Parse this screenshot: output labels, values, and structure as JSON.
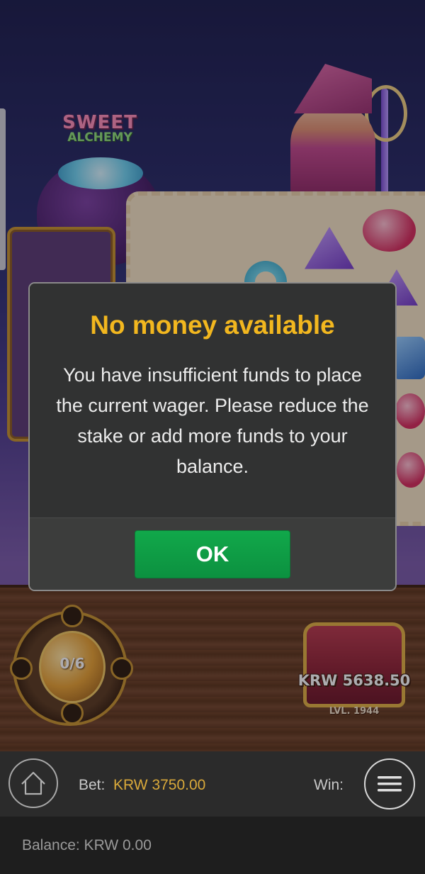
{
  "game": {
    "logo_line1": "SWEET",
    "logo_line2": "ALCHEMY",
    "counter": "0/6",
    "chest_amount": "KRW 5638.50",
    "chest_level": "LVL. 1944"
  },
  "dialog": {
    "title": "No money available",
    "message": "You have insufficient funds to place the current wager. Please reduce the stake or add more funds to your balance.",
    "ok_label": "OK"
  },
  "bottom_bar": {
    "bet_label": "Bet:",
    "bet_value": "KRW 3750.00",
    "win_label": "Win:",
    "balance": "Balance: KRW 0.00"
  },
  "icons": {
    "home": "home-icon",
    "menu": "hamburger-menu-icon"
  },
  "colors": {
    "title_accent": "#f2b71f",
    "ok_button": "#11a84a",
    "bet_value": "#d9a93a"
  }
}
